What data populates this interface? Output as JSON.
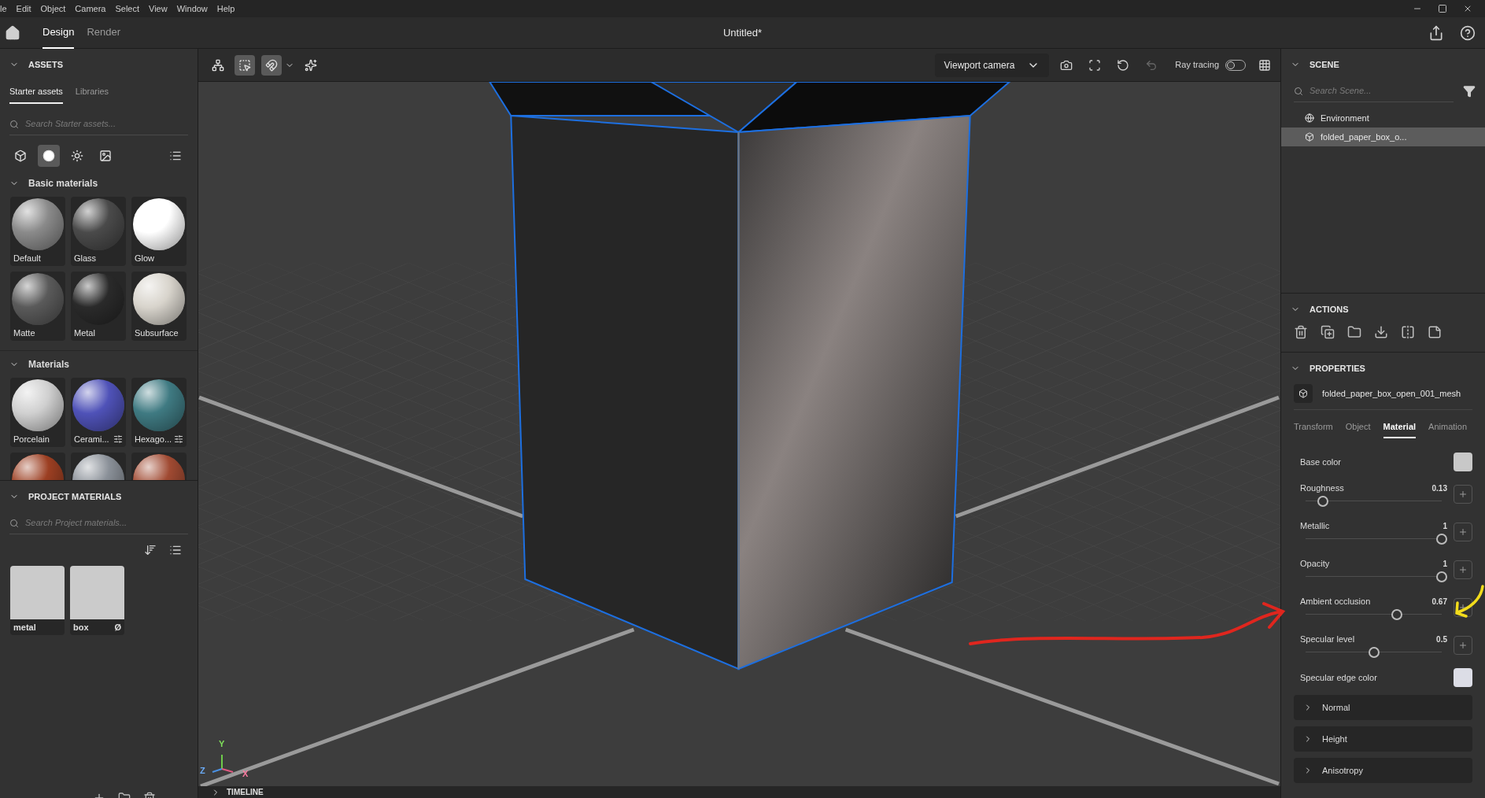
{
  "menu": [
    "le",
    "Edit",
    "Object",
    "Camera",
    "Select",
    "View",
    "Window",
    "Help"
  ],
  "window": {
    "title": "Untitled*"
  },
  "mode_tabs": [
    {
      "label": "Design",
      "selected": true
    },
    {
      "label": "Render",
      "selected": false
    }
  ],
  "assets": {
    "title": "ASSETS",
    "expanded": true,
    "tabs": [
      {
        "label": "Starter assets",
        "selected": true
      },
      {
        "label": "Libraries",
        "selected": false
      }
    ],
    "search": {
      "placeholder": "Search Starter assets..."
    },
    "filters": [
      {
        "kind": "model",
        "selected": false
      },
      {
        "kind": "material",
        "selected": true
      },
      {
        "kind": "light",
        "selected": false
      },
      {
        "kind": "image",
        "selected": false
      }
    ],
    "groups": [
      {
        "title": "Basic materials",
        "expanded": true,
        "items": [
          {
            "label": "Default",
            "color": "#8a8a8a",
            "adjustable": false
          },
          {
            "label": "Glass",
            "color": "#4a4a4a",
            "adjustable": false
          },
          {
            "label": "Glow",
            "color": "#ffffff",
            "adjustable": false
          },
          {
            "label": "Matte",
            "color": "#5a5a5a",
            "adjustable": false
          },
          {
            "label": "Metal",
            "color": "#2a2a2a",
            "adjustable": false
          },
          {
            "label": "Subsurface",
            "color": "#d8d4cc",
            "adjustable": false
          }
        ]
      },
      {
        "title": "Materials",
        "expanded": true,
        "items": [
          {
            "label": "Porcelain",
            "color": "#d0d0d0",
            "adjustable": false
          },
          {
            "label": "Cerami...",
            "color": "#4f52b8",
            "adjustable": true
          },
          {
            "label": "Hexago...",
            "color": "#3f7a82",
            "adjustable": true
          },
          {
            "color": "#9c3f22"
          },
          {
            "color": "#8a9098"
          },
          {
            "color": "#a04a32"
          }
        ]
      }
    ]
  },
  "project_materials": {
    "title": "PROJECT MATERIALS",
    "expanded": true,
    "search": {
      "placeholder": "Search Project materials..."
    },
    "items": [
      {
        "label": "metal"
      },
      {
        "label": "box",
        "badge": "Ø"
      }
    ]
  },
  "viewport": {
    "camera": "Viewport camera",
    "ray_tracing": {
      "label": "Ray tracing",
      "on": false
    },
    "tools": [
      {
        "kind": "hierarchy",
        "selected": false
      },
      {
        "kind": "select",
        "selected": true
      },
      {
        "kind": "magnet",
        "selected": true
      },
      {
        "kind": "sparkle",
        "selected": false
      }
    ],
    "camera_tools": [
      {
        "kind": "add",
        "disabled": false
      },
      {
        "kind": "frame",
        "disabled": false
      },
      {
        "kind": "reset",
        "disabled": false
      },
      {
        "kind": "undo",
        "disabled": true
      }
    ],
    "axes": [
      "Y",
      "Z",
      "X"
    ]
  },
  "timeline": {
    "title": "TIMELINE",
    "expanded": false
  },
  "scene": {
    "title": "SCENE",
    "expanded": true,
    "search": {
      "placeholder": "Search Scene..."
    },
    "items": [
      {
        "kind": "environment",
        "label": "Environment",
        "selected": false
      },
      {
        "kind": "mesh",
        "label": "folded_paper_box_o...",
        "selected": true
      }
    ]
  },
  "actions": {
    "title": "ACTIONS",
    "expanded": true
  },
  "properties": {
    "title": "PROPERTIES",
    "expanded": true,
    "object": "folded_paper_box_open_001_mesh",
    "tabs": [
      {
        "label": "Transform",
        "selected": false
      },
      {
        "label": "Object",
        "selected": false
      },
      {
        "label": "Material",
        "selected": true
      },
      {
        "label": "Animation",
        "selected": false
      }
    ],
    "rows": [
      {
        "kind": "color",
        "label": "Base color",
        "color": "#c8c8c8"
      },
      {
        "kind": "slider",
        "label": "Roughness",
        "value": "0.13",
        "level": 0.13
      },
      {
        "kind": "slider",
        "label": "Metallic",
        "value": "1",
        "level": 1
      },
      {
        "kind": "slider",
        "label": "Opacity",
        "value": "1",
        "level": 1
      },
      {
        "kind": "slider",
        "label": "Ambient occlusion",
        "value": "0.67",
        "level": 0.67
      },
      {
        "kind": "slider",
        "label": "Specular level",
        "value": "0.5",
        "level": 0.5
      },
      {
        "kind": "color",
        "label": "Specular edge color",
        "color": "#dcdde6"
      }
    ],
    "sections": [
      {
        "label": "Normal",
        "expanded": false
      },
      {
        "label": "Height",
        "expanded": false
      },
      {
        "label": "Anisotropy",
        "expanded": false
      }
    ]
  }
}
